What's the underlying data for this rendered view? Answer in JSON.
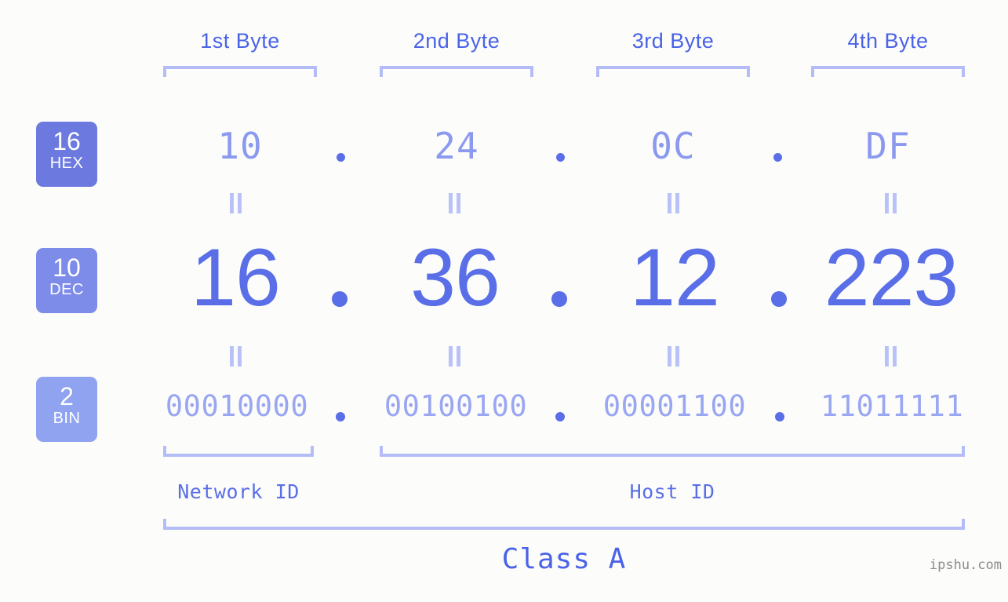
{
  "meta": {
    "background_color": "#fcfdfa",
    "accent_color": "#5a6ee8",
    "bracket_color": "#b4bdf7"
  },
  "byte_headers": [
    {
      "label": "1st Byte"
    },
    {
      "label": "2nd Byte"
    },
    {
      "label": "3rd Byte"
    },
    {
      "label": "4th Byte"
    }
  ],
  "bases": [
    {
      "number": "16",
      "name": "HEX",
      "color": "#6c7ae0"
    },
    {
      "number": "10",
      "name": "DEC",
      "color": "#7d8ce8"
    },
    {
      "number": "2",
      "name": "BIN",
      "color": "#8fa3f0"
    }
  ],
  "rows": {
    "hex": {
      "base_number": "16",
      "base_name": "HEX",
      "bytes": [
        "10",
        "24",
        "0C",
        "DF"
      ],
      "separator": "."
    },
    "dec": {
      "base_number": "10",
      "base_name": "DEC",
      "bytes": [
        "16",
        "36",
        "12",
        "223"
      ],
      "separator": "."
    },
    "bin": {
      "base_number": "2",
      "base_name": "BIN",
      "bytes": [
        "00010000",
        "00100100",
        "00001100",
        "11011111"
      ],
      "separator": "."
    }
  },
  "partitions": {
    "network_id": "Network ID",
    "host_id": "Host ID",
    "class": "Class A"
  },
  "watermark": "ipshu.com"
}
